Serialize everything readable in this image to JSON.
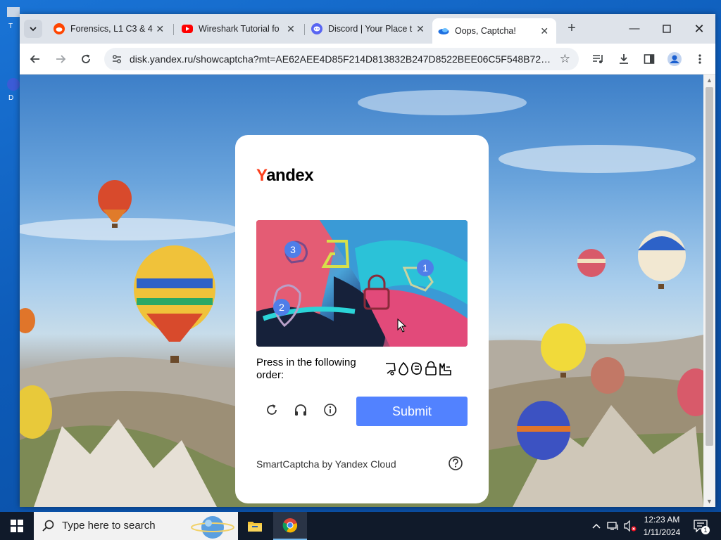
{
  "browser": {
    "tabs": [
      {
        "title": "Forensics, L1 C3 & 4",
        "icon": "reddit-icon",
        "active": false
      },
      {
        "title": "Wireshark Tutorial fo",
        "icon": "youtube-icon",
        "active": false
      },
      {
        "title": "Discord | Your Place t",
        "icon": "discord-icon",
        "active": false
      },
      {
        "title": "Oops, Captcha!",
        "icon": "yandex-disk-icon",
        "active": true
      }
    ],
    "url": "disk.yandex.ru/showcaptcha?mt=AE62AEE4D85F214D813832B247D8522BEE06C5F548B72B162..."
  },
  "captcha": {
    "logo_first": "Y",
    "logo_rest": "andex",
    "instruction": "Press in the following order:",
    "markers": [
      "1",
      "2",
      "3"
    ],
    "submit_label": "Submit",
    "footer": "SmartCaptcha by Yandex Cloud"
  },
  "taskbar": {
    "search_placeholder": "Type here to search",
    "time": "12:23 AM",
    "date": "1/11/2024",
    "notification_count": "1"
  },
  "colors": {
    "yandex_red": "#fc3f1d",
    "submit_blue": "#5282ff",
    "marker_blue": "#4f7ee8"
  }
}
